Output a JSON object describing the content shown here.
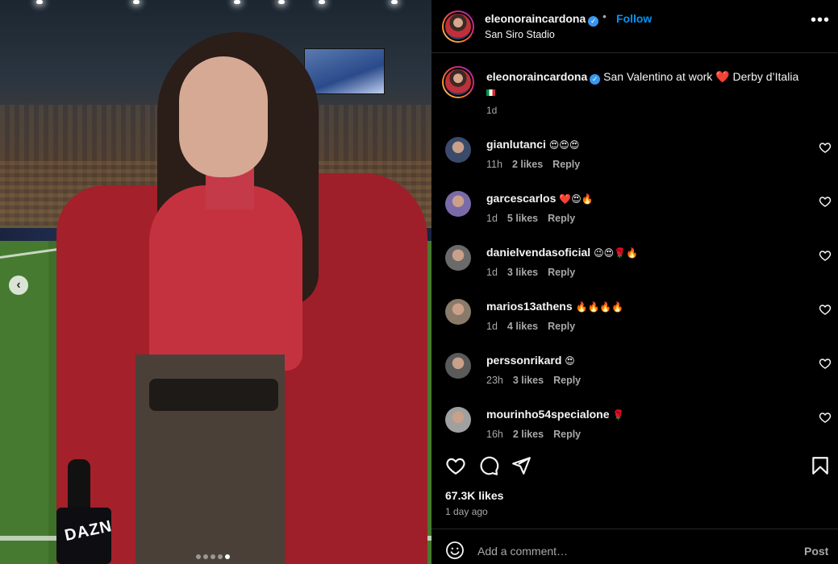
{
  "post": {
    "author": "eleonoraincardona",
    "follow_label": "Follow",
    "location": "San Siro Stadio",
    "caption": "San Valentino at work ❤️ Derby d’Italia",
    "caption_time": "1d",
    "carousel": {
      "slide_count": 5,
      "active_index": 4
    }
  },
  "comments": [
    {
      "user": "gianlutanci",
      "text": "😍😍😍",
      "time": "11h",
      "likes": "2 likes",
      "reply": "Reply",
      "avatar_color": "#3a4a6a"
    },
    {
      "user": "garcescarlos",
      "text": "❤️😍🔥",
      "time": "1d",
      "likes": "5 likes",
      "reply": "Reply",
      "avatar_color": "#7a6aa8"
    },
    {
      "user": "danielvendasoficial",
      "text": "😉😍🌹🔥",
      "time": "1d",
      "likes": "3 likes",
      "reply": "Reply",
      "avatar_color": "#6a6a6a"
    },
    {
      "user": "marios13athens",
      "text": "🔥🔥🔥🔥",
      "time": "1d",
      "likes": "4 likes",
      "reply": "Reply",
      "avatar_color": "#8a7a6a"
    },
    {
      "user": "perssonrikard",
      "text": "😍",
      "time": "23h",
      "likes": "3 likes",
      "reply": "Reply",
      "avatar_color": "#5a5a5a"
    },
    {
      "user": "mourinho54specialone",
      "text": "🌹",
      "time": "16h",
      "likes": "2 likes",
      "reply": "Reply",
      "avatar_color": "#a0a0a0"
    }
  ],
  "stats": {
    "likes": "67.3K likes",
    "posted": "1 day ago"
  },
  "composer": {
    "placeholder": "Add a comment…",
    "post_label": "Post"
  },
  "icons": {
    "like": "heart-icon",
    "comment": "comment-icon",
    "share": "share-icon",
    "save": "bookmark-icon",
    "more": "more-icon",
    "emoji": "emoji-icon",
    "prev": "chevron-left-icon",
    "verified": "verified-icon"
  },
  "colors": {
    "accent": "#0095f6",
    "verified": "#3897f0",
    "muted": "#a8a8a8"
  }
}
